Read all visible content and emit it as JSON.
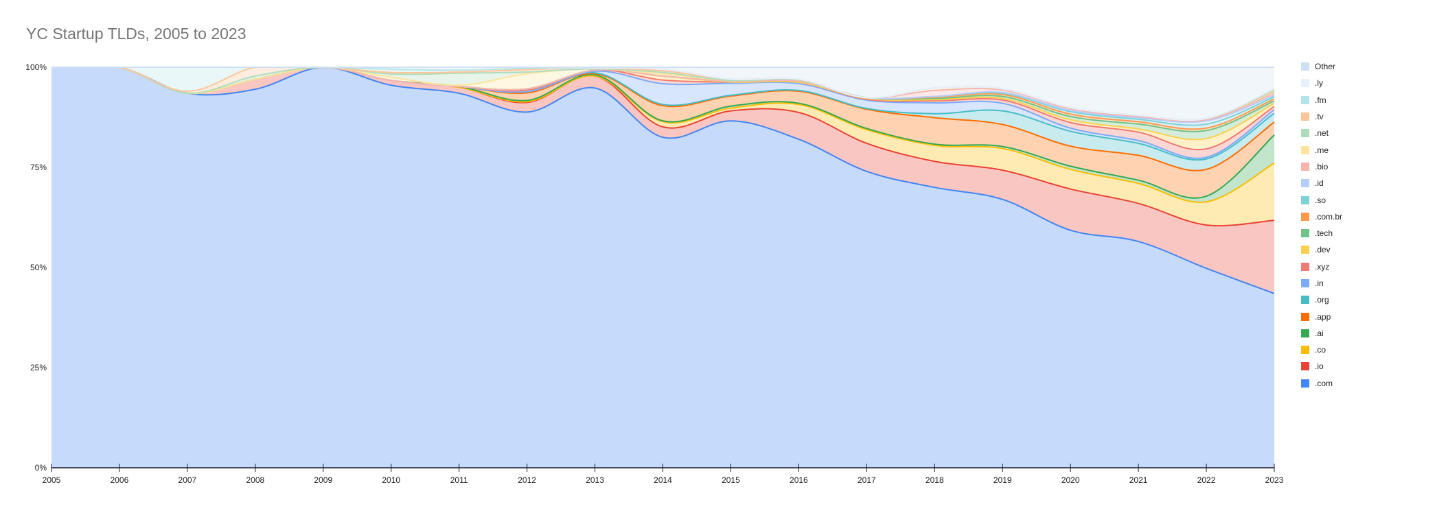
{
  "chart_data": {
    "type": "area",
    "stacked": "percent",
    "smooth": true,
    "title": "YC Startup TLDs, 2005 to 2023",
    "xlabel": "",
    "ylabel": "",
    "ylim": [
      0,
      100
    ],
    "y_ticks": [
      "0%",
      "25%",
      "50%",
      "75%",
      "100%"
    ],
    "x": [
      "2005",
      "2006",
      "2007",
      "2008",
      "2009",
      "2010",
      "2011",
      "2012",
      "2013",
      "2014",
      "2015",
      "2016",
      "2017",
      "2018",
      "2019",
      "2020",
      "2021",
      "2022",
      "2023"
    ],
    "legend_position": "right",
    "grid": false,
    "series": [
      {
        "name": ".com",
        "color": "#4285f4",
        "values": [
          100,
          100,
          93.5,
          94.5,
          100,
          95.5,
          93.5,
          88.8,
          94.8,
          82.5,
          86.6,
          82.0,
          74.0,
          70.0,
          67.0,
          59.3,
          56.5,
          49.8,
          43.5
        ]
      },
      {
        "name": ".io",
        "color": "#ea4335",
        "values": [
          0,
          0,
          0,
          2.5,
          0,
          1.2,
          1.5,
          2.4,
          3.0,
          2.6,
          2.5,
          6.7,
          7.0,
          6.5,
          7.3,
          10.3,
          9.5,
          10.8,
          18.3
        ]
      },
      {
        "name": ".co",
        "color": "#fbbc04",
        "values": [
          0,
          0,
          0,
          0,
          0,
          0,
          0,
          0.2,
          0,
          1.3,
          0.7,
          2.0,
          3.4,
          4.0,
          5.4,
          4.9,
          5.0,
          5.8,
          14.3
        ]
      },
      {
        "name": ".ai",
        "color": "#34a853",
        "values": [
          0,
          0,
          0,
          0,
          0,
          0,
          0.2,
          0.3,
          0.3,
          0.2,
          0.5,
          0.3,
          0.3,
          0.3,
          0.5,
          0.8,
          0.8,
          1.4,
          7.0
        ]
      },
      {
        "name": ".app",
        "color": "#ff6d01",
        "values": [
          0,
          0,
          0,
          0,
          0,
          0,
          0,
          1.9,
          0.3,
          3.8,
          2.5,
          3.0,
          4.8,
          6.6,
          5.5,
          5.0,
          6.2,
          6.7,
          3.2
        ]
      },
      {
        "name": ".org",
        "color": "#46bdc6",
        "values": [
          0,
          0,
          0,
          0,
          0,
          0,
          0,
          0.3,
          0.2,
          0.3,
          0.2,
          0.2,
          0.2,
          1.0,
          3.4,
          3.7,
          3.0,
          2.6,
          2.2
        ]
      },
      {
        "name": ".in",
        "color": "#7baaf7",
        "values": [
          0,
          0,
          0,
          0,
          0,
          0,
          0,
          0,
          0.4,
          5.2,
          3.0,
          1.7,
          2.1,
          2.7,
          1.9,
          0.8,
          0.7,
          0.4,
          0.9
        ]
      },
      {
        "name": ".xyz",
        "color": "#f07b72",
        "values": [
          0,
          0,
          0,
          0,
          0,
          0,
          0,
          0.4,
          0.3,
          0.9,
          0.3,
          0.3,
          0.2,
          0.5,
          0.8,
          1.4,
          2.1,
          2.1,
          0.8
        ]
      },
      {
        "name": ".dev",
        "color": "#fcd04f",
        "values": [
          0,
          0,
          0,
          0,
          0,
          0,
          0,
          0.3,
          0,
          1.0,
          0,
          0,
          0.2,
          0.3,
          0.4,
          0.7,
          0.8,
          2.6,
          0.8
        ]
      },
      {
        "name": ".tech",
        "color": "#71c287",
        "values": [
          0,
          0,
          0,
          0,
          0,
          0,
          0,
          0,
          0,
          0,
          0.2,
          0.3,
          0.2,
          0.3,
          0.5,
          0.8,
          1.2,
          2.0,
          0.6
        ]
      },
      {
        "name": ".com.br",
        "color": "#ff994d",
        "values": [
          0,
          0,
          0,
          0,
          0,
          0,
          0,
          0,
          0,
          0,
          0,
          0,
          0,
          0.3,
          0.5,
          0.6,
          0.6,
          0.6,
          0.5
        ]
      },
      {
        "name": ".so",
        "color": "#7ed1d7",
        "values": [
          0,
          0,
          0,
          0,
          0,
          0,
          0,
          0,
          0,
          0,
          0,
          0,
          0,
          0.2,
          0.3,
          0.6,
          0.6,
          1.0,
          0.5
        ]
      },
      {
        "name": ".id",
        "color": "#b3cefb",
        "values": [
          0,
          0,
          0,
          0,
          0,
          0,
          0,
          0,
          0,
          0,
          0,
          0,
          0,
          0,
          0.2,
          0.3,
          0.4,
          0.8,
          0.4
        ]
      },
      {
        "name": ".bio",
        "color": "#f7b4ae",
        "values": [
          0,
          0,
          0,
          0,
          0,
          0,
          0,
          0,
          0,
          0,
          0,
          0,
          0,
          1.5,
          0.6,
          0.4,
          0.3,
          0.3,
          0.5
        ]
      },
      {
        "name": ".me",
        "color": "#fde49b",
        "values": [
          0,
          0,
          0,
          0,
          0,
          0.8,
          0.3,
          3.8,
          0.3,
          0.5,
          0.2,
          0.3,
          0,
          0.6,
          0.3,
          0.3,
          0.3,
          0.3,
          0.4
        ]
      },
      {
        "name": ".net",
        "color": "#aedcba",
        "values": [
          0,
          0,
          0,
          0.8,
          0,
          0.8,
          3.0,
          0.4,
          0,
          0.4,
          0,
          0,
          0,
          0,
          0,
          0,
          0,
          0,
          0.2
        ]
      },
      {
        "name": ".tv",
        "color": "#ffc599",
        "values": [
          0,
          0,
          0.5,
          2.2,
          0,
          0.4,
          0.3,
          0.6,
          0.2,
          0.4,
          0.3,
          0.2,
          0,
          0,
          0,
          0,
          0,
          0,
          0.2
        ]
      },
      {
        "name": ".fm",
        "color": "#b5e4e8",
        "values": [
          0,
          0,
          6.0,
          0,
          0,
          0.8,
          0.5,
          0.3,
          0,
          0.5,
          0,
          0,
          0,
          0,
          0,
          0,
          0,
          0,
          0.2
        ]
      },
      {
        "name": ".ly",
        "color": "#e8f0fe",
        "values": [
          0,
          0,
          0,
          0,
          0,
          0.5,
          0.7,
          0.3,
          0,
          0,
          0,
          0,
          0,
          0,
          0,
          0,
          0,
          0,
          0.2
        ]
      },
      {
        "name": "Other",
        "color": "#cfe0f2",
        "values": [
          0,
          0,
          0,
          0,
          0,
          0,
          0,
          0,
          0.2,
          0.4,
          3.0,
          3.0,
          7.6,
          5.2,
          5.4,
          10.1,
          12.0,
          12.8,
          5.3
        ]
      }
    ]
  }
}
